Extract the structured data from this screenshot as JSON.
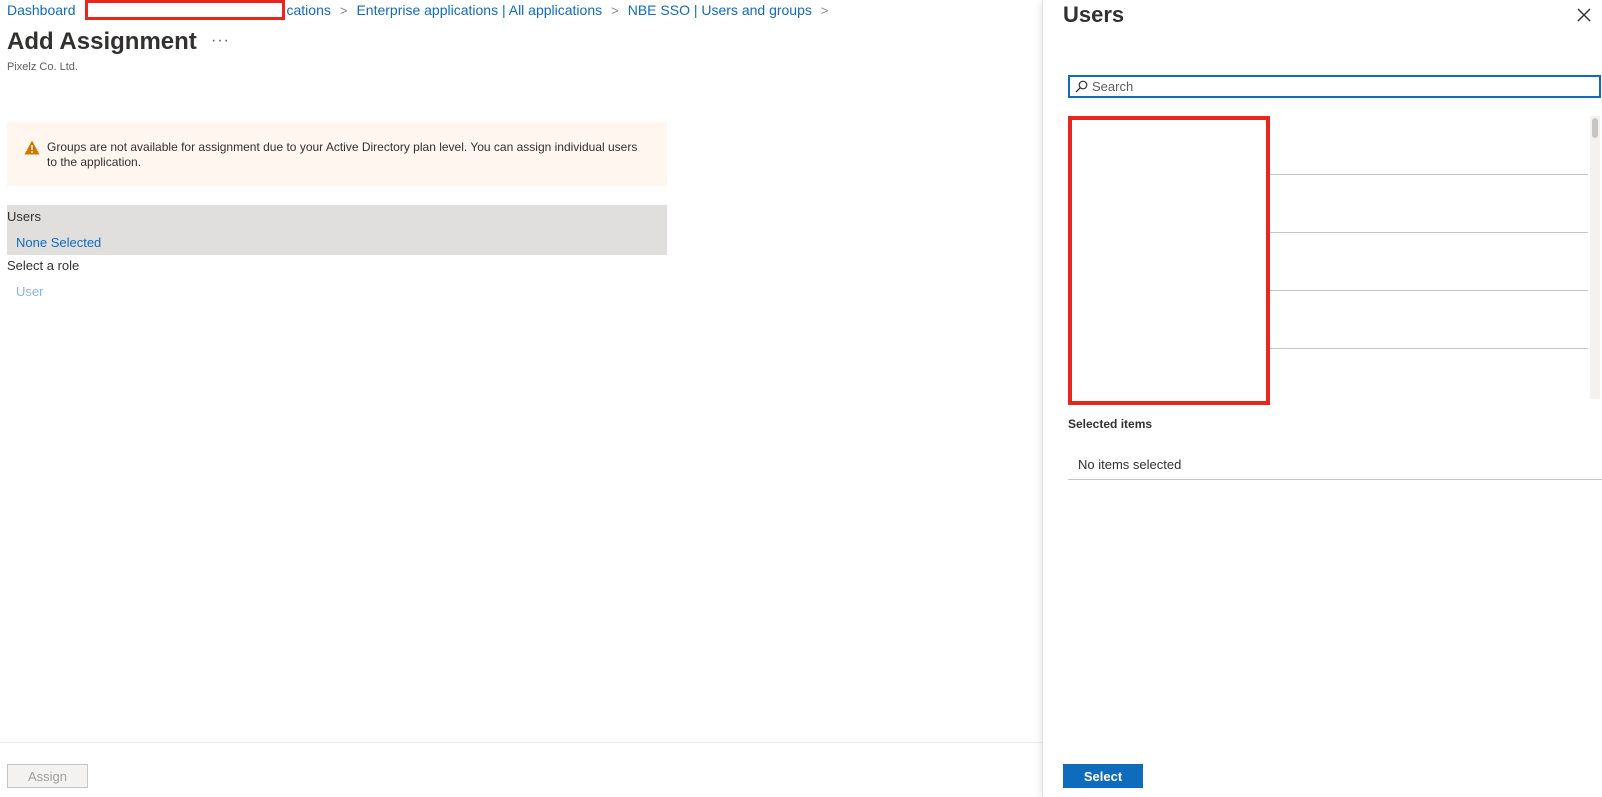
{
  "breadcrumb": {
    "items": [
      "Dashboard",
      "cations",
      "Enterprise applications | All applications",
      "NBE SSO | Users and groups"
    ],
    "separator": ">"
  },
  "page": {
    "title": "Add Assignment",
    "more": "···",
    "subtitle": "Pixelz Co. Ltd."
  },
  "warning": {
    "text": "Groups are not available for assignment due to your Active Directory plan level. You can assign individual users to the application."
  },
  "assignment": {
    "users_label": "Users",
    "users_value": "None Selected",
    "role_label": "Select a role",
    "role_value": "User"
  },
  "footer": {
    "assign_label": "Assign"
  },
  "panel": {
    "title": "Users",
    "search_placeholder": "Search",
    "selected_title": "Selected items",
    "selected_empty": "No items selected",
    "select_label": "Select"
  },
  "colors": {
    "accent": "#0f6cbd",
    "redaction": "#e8261b",
    "warning_bg": "#fef6ef",
    "warning_icon": "#d47500"
  }
}
